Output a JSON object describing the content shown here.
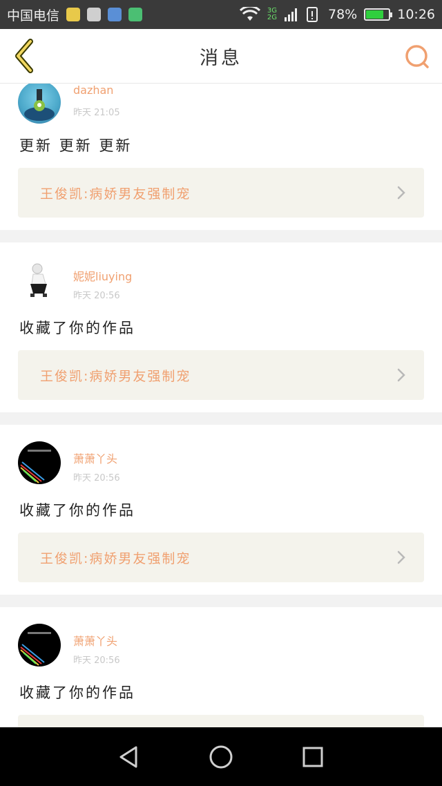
{
  "status_bar": {
    "carrier": "中国电信",
    "network_top": "3G",
    "network_bottom": "2G",
    "battery_percent": "78%",
    "battery_level": 0.78,
    "time": "10:26",
    "app_icon_colors": [
      "#e8c94a",
      "#cfcfcf",
      "#5a8fd6",
      "#4bbf73"
    ]
  },
  "header": {
    "title": "消息",
    "back_icon": "chevron-left-icon",
    "search_icon": "search-icon",
    "accent_color": "#f0a070"
  },
  "messages": [
    {
      "username": "dazhan",
      "time": "昨天 21:05",
      "text": "更新 更新 更新",
      "work_title": "王俊凯:病娇男友强制宠"
    },
    {
      "username": "妮妮liuying",
      "time": "昨天 20:56",
      "text": "收藏了你的作品",
      "work_title": "王俊凯:病娇男友强制宠"
    },
    {
      "username": "萧萧丫头",
      "time": "昨天 20:56",
      "text": "收藏了你的作品",
      "work_title": "王俊凯:病娇男友强制宠"
    },
    {
      "username": "萧萧丫头",
      "time": "昨天 20:56",
      "text": "收藏了你的作品",
      "work_title": ""
    }
  ],
  "nav_bar": {
    "back": "triangle-back-icon",
    "home": "circle-home-icon",
    "recents": "square-recents-icon"
  }
}
